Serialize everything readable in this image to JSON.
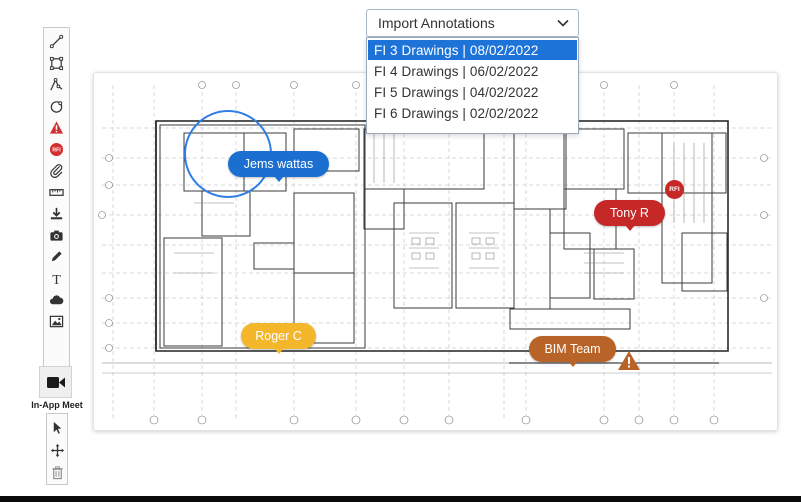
{
  "toolbar": {
    "tools": [
      {
        "name": "line-tool",
        "icon": "line-icon"
      },
      {
        "name": "rectangle-tool",
        "icon": "rectangle-icon"
      },
      {
        "name": "polyline-tool",
        "icon": "polyline-icon"
      },
      {
        "name": "circle-tool",
        "icon": "circle-icon"
      },
      {
        "name": "issue-tool",
        "icon": "warning-icon"
      },
      {
        "name": "rfi-tool",
        "icon": "rfi-icon",
        "text": "RFI"
      },
      {
        "name": "attach-tool",
        "icon": "paperclip-icon"
      },
      {
        "name": "measure-tool",
        "icon": "ruler-icon"
      },
      {
        "name": "download-tool",
        "icon": "download-icon"
      },
      {
        "name": "camera-tool",
        "icon": "camera-icon"
      },
      {
        "name": "pen-tool",
        "icon": "pencil-icon"
      },
      {
        "name": "text-tool",
        "icon": "text-icon",
        "text": "T"
      },
      {
        "name": "cloud-tool",
        "icon": "cloud-icon"
      },
      {
        "name": "image-tool",
        "icon": "image-icon"
      }
    ],
    "meet_label": "In-App Meet",
    "bottom_tools": [
      "pointer-icon",
      "move-icon",
      "trash-icon"
    ]
  },
  "import": {
    "placeholder": "Import Annotations",
    "options": [
      "FI 3 Drawings | 08/02/2022",
      "FI 4 Drawings | 06/02/2022",
      "FI 5 Drawings | 04/02/2022",
      "FI 6 Drawings | 02/02/2022"
    ],
    "selected_index": 0
  },
  "annotations": {
    "blue": "Jems wattas",
    "red": "Tony R",
    "yellow": "Roger C",
    "brown": "BIM Team",
    "rfi": "RFI"
  },
  "colors": {
    "accent": "#1e73d8",
    "blue": "#1a6fd1",
    "red": "#c62828",
    "yellow": "#f4b62b",
    "brown": "#b86428"
  }
}
